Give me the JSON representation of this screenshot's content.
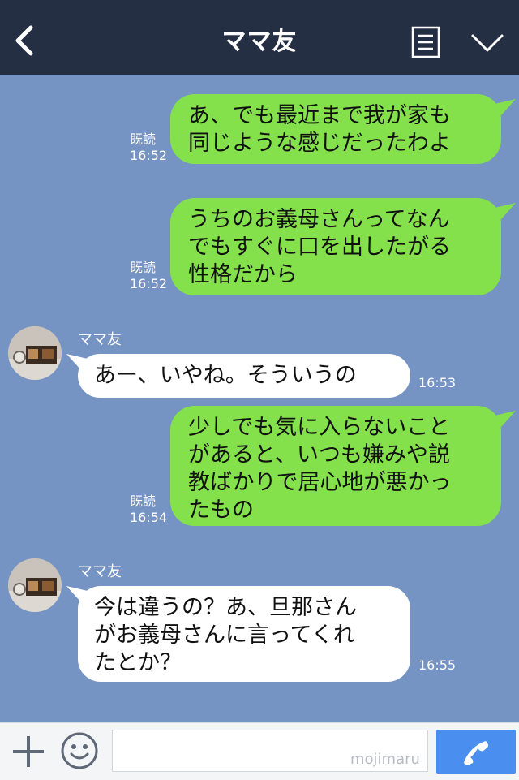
{
  "header": {
    "title": "ママ友",
    "back_icon": "chevron-left-icon",
    "menu_icon": "list-icon",
    "dropdown_icon": "chevron-down-icon"
  },
  "messages": [
    {
      "side": "out",
      "lines": [
        "あ、でも最近まで我が家も",
        "同じような感じだったわよ"
      ],
      "read": "既読",
      "time": "16:52"
    },
    {
      "side": "out",
      "lines": [
        "うちのお義母さんってなん",
        "でもすぐに口を出したがる",
        "性格だから"
      ],
      "read": "既読",
      "time": "16:52"
    },
    {
      "side": "in",
      "sender": "ママ友",
      "lines": [
        "あー、いやね。そういうの"
      ],
      "time": "16:53"
    },
    {
      "side": "out",
      "lines": [
        "少しでも気に入らないこと",
        "があると、いつも嫌みや説",
        "教ばかりで居心地が悪かっ",
        "たもの"
      ],
      "read": "既読",
      "time": "16:54"
    },
    {
      "side": "in",
      "sender": "ママ友",
      "lines": [
        "今は違うの？あ、旦那さん",
        "がお義母さんに言ってくれ",
        "たとか？"
      ],
      "time": "16:55"
    }
  ],
  "input": {
    "placeholder": "",
    "value": "",
    "watermark": "mojimaru"
  },
  "toolbar": {
    "plus_icon": "plus-icon",
    "emoji_icon": "smiley-icon",
    "call_icon": "phone-icon"
  },
  "colors": {
    "header_bg": "#252f44",
    "chat_bg": "#7593c3",
    "outgoing_bubble": "#84e14b",
    "incoming_bubble": "#ffffff",
    "call_button": "#4a8ef0"
  }
}
